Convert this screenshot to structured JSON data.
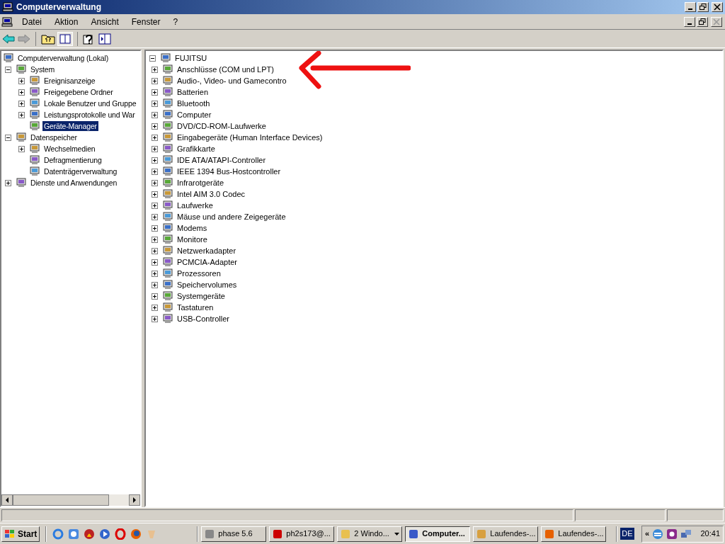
{
  "window": {
    "title": "Computerverwaltung"
  },
  "menu": [
    "Datei",
    "Aktion",
    "Ansicht",
    "Fenster",
    "?"
  ],
  "left_tree": [
    {
      "label": "Computerverwaltung (Lokal)",
      "kind": "root",
      "selected": false,
      "children": [
        {
          "label": "System",
          "kind": "branch",
          "expanded": true,
          "selected": false,
          "children": [
            {
              "label": "Ereignisanzeige",
              "kind": "branch",
              "expanded": false,
              "selected": false
            },
            {
              "label": "Freigegebene Ordner",
              "kind": "branch",
              "expanded": false,
              "selected": false
            },
            {
              "label": "Lokale Benutzer und Gruppe",
              "kind": "branch",
              "expanded": false,
              "selected": false
            },
            {
              "label": "Leistungsprotokolle und War",
              "kind": "branch",
              "expanded": false,
              "selected": false
            },
            {
              "label": "Geräte-Manager",
              "kind": "leaf",
              "selected": true
            }
          ]
        },
        {
          "label": "Datenspeicher",
          "kind": "branch",
          "expanded": true,
          "selected": false,
          "children": [
            {
              "label": "Wechselmedien",
              "kind": "branch",
              "expanded": false,
              "selected": false
            },
            {
              "label": "Defragmentierung",
              "kind": "leaf",
              "selected": false
            },
            {
              "label": "Datenträgerverwaltung",
              "kind": "leaf",
              "selected": false
            }
          ]
        },
        {
          "label": "Dienste und Anwendungen",
          "kind": "branch",
          "expanded": false,
          "selected": false
        }
      ]
    }
  ],
  "device_tree": [
    {
      "label": "FUJITSU",
      "kind": "branch",
      "expanded": true,
      "children": [
        {
          "label": "Anschlüsse (COM und LPT)",
          "kind": "branch",
          "expanded": false
        },
        {
          "label": "Audio-, Video- und Gamecontro",
          "kind": "branch",
          "expanded": false
        },
        {
          "label": "Batterien",
          "kind": "branch",
          "expanded": false
        },
        {
          "label": "Bluetooth",
          "kind": "branch",
          "expanded": false
        },
        {
          "label": "Computer",
          "kind": "branch",
          "expanded": false
        },
        {
          "label": "DVD/CD-ROM-Laufwerke",
          "kind": "branch",
          "expanded": false
        },
        {
          "label": "Eingabegeräte (Human Interface Devices)",
          "kind": "branch",
          "expanded": false
        },
        {
          "label": "Grafikkarte",
          "kind": "branch",
          "expanded": false
        },
        {
          "label": "IDE ATA/ATAPI-Controller",
          "kind": "branch",
          "expanded": false
        },
        {
          "label": "IEEE 1394 Bus-Hostcontroller",
          "kind": "branch",
          "expanded": false
        },
        {
          "label": "Infrarotgeräte",
          "kind": "branch",
          "expanded": false
        },
        {
          "label": "Intel AIM 3.0 Codec",
          "kind": "branch",
          "expanded": false
        },
        {
          "label": "Laufwerke",
          "kind": "branch",
          "expanded": false
        },
        {
          "label": "Mäuse und andere Zeigegeräte",
          "kind": "branch",
          "expanded": false
        },
        {
          "label": "Modems",
          "kind": "branch",
          "expanded": false
        },
        {
          "label": "Monitore",
          "kind": "branch",
          "expanded": false
        },
        {
          "label": "Netzwerkadapter",
          "kind": "branch",
          "expanded": false
        },
        {
          "label": "PCMCIA-Adapter",
          "kind": "branch",
          "expanded": false
        },
        {
          "label": "Prozessoren",
          "kind": "branch",
          "expanded": false
        },
        {
          "label": "Speichervolumes",
          "kind": "branch",
          "expanded": false
        },
        {
          "label": "Systemgeräte",
          "kind": "branch",
          "expanded": false
        },
        {
          "label": "Tastaturen",
          "kind": "branch",
          "expanded": false
        },
        {
          "label": "USB-Controller",
          "kind": "branch",
          "expanded": false
        }
      ]
    }
  ],
  "taskbar": {
    "start": "Start",
    "tasks": [
      {
        "label": "phase 5.6",
        "selected": false
      },
      {
        "label": "ph2s173@...",
        "selected": false
      },
      {
        "label": "2 Windo...",
        "selected": false,
        "kind": "group"
      },
      {
        "label": "Computer...",
        "selected": true
      },
      {
        "label": "Laufendes-...",
        "selected": false
      },
      {
        "label": "Laufendes-...",
        "selected": false
      }
    ],
    "language": "DE",
    "tray_toggle": "«",
    "clock": "20:41"
  }
}
